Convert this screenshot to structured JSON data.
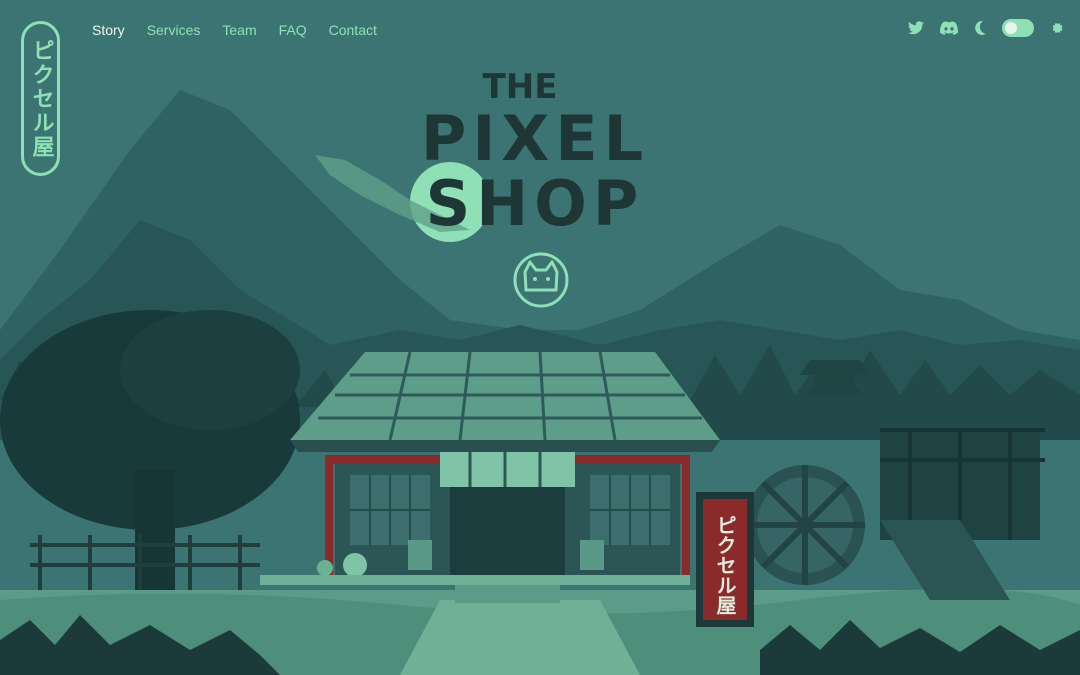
{
  "logo": {
    "text": "ピクセル屋"
  },
  "nav": {
    "items": [
      {
        "label": "Story"
      },
      {
        "label": "Services"
      },
      {
        "label": "Team"
      },
      {
        "label": "FAQ"
      },
      {
        "label": "Contact"
      }
    ]
  },
  "hero": {
    "title_line1": "THE",
    "title_line2": "PIXEL",
    "title_line3": "SHOP",
    "shop_sign": "ピクセル屋"
  },
  "header_icons": {
    "twitter": "twitter-icon",
    "discord": "discord-icon",
    "moon": "moon-icon",
    "settings": "gear-icon"
  },
  "theme_toggle": {
    "state": "on"
  },
  "colors": {
    "sky": "#3c7474",
    "accent": "#8fe0b6",
    "dark_ink": "#1f3636",
    "red": "#8a2a2a"
  }
}
